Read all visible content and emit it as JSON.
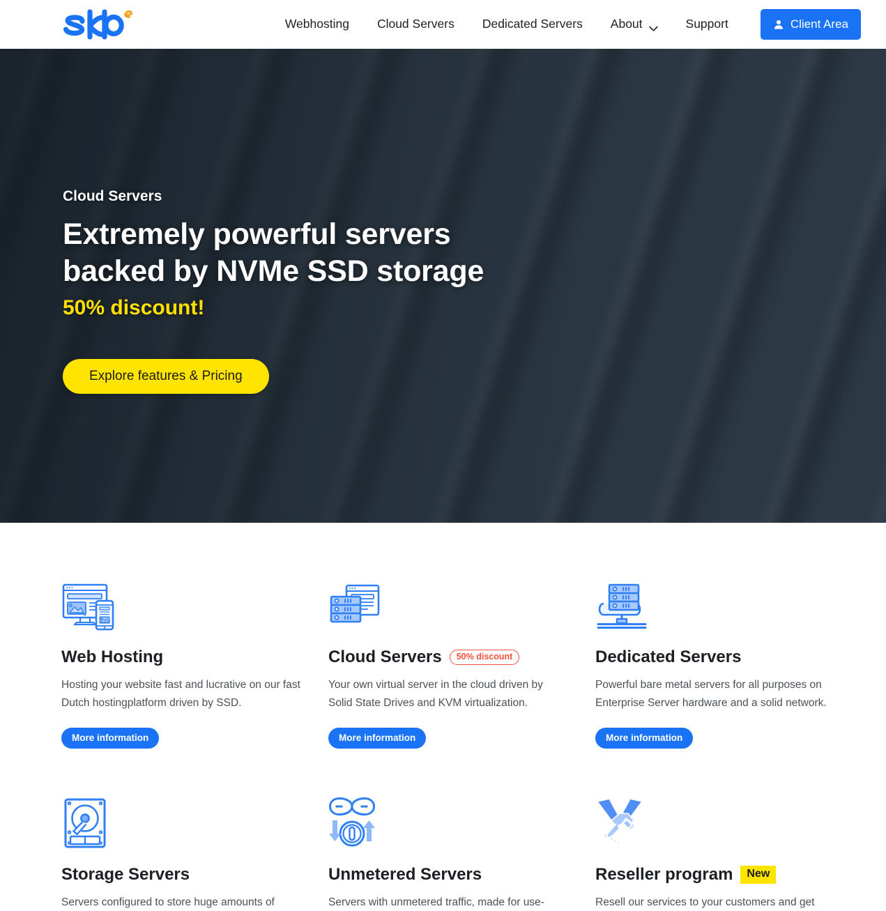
{
  "brand": {
    "logo_text": "skb",
    "logo_sup": "e",
    "logo_color": "#1a73f5",
    "logo_sup_color": "#f5a623"
  },
  "header": {
    "nav": [
      {
        "label": "Webhosting",
        "icon": ""
      },
      {
        "label": "Cloud Servers",
        "icon": ""
      },
      {
        "label": "Dedicated Servers",
        "icon": ""
      },
      {
        "label": "About",
        "icon": "chevron-down-icon"
      },
      {
        "label": "Support",
        "icon": ""
      }
    ],
    "client_area": {
      "label": "Client Area",
      "icon": "user-icon",
      "color": "#1a73f5"
    }
  },
  "hero": {
    "eyebrow": "Cloud Servers",
    "title_line1": "Extremely powerful servers",
    "title_line2": "backed by NVMe SSD storage",
    "discount": "50% discount!",
    "discount_color": "#ffe000",
    "cta_label": "Explore features & Pricing",
    "cta_color": "#ffe400",
    "background": "blurred-server-rack-photo"
  },
  "services": {
    "cards": [
      {
        "icon": "web-hosting-icon",
        "title": "Web Hosting",
        "badge": null,
        "badge_type": null,
        "desc": "Hosting your website fast and lucrative on our fast Dutch hostingplatform driven by SSD.",
        "button": "More information"
      },
      {
        "icon": "cloud-servers-icon",
        "title": "Cloud Servers",
        "badge": "50% discount",
        "badge_type": "discount",
        "badge_color": "#f4523b",
        "desc": "Your own virtual server in the cloud driven by Solid State Drives and KVM virtualization.",
        "button": "More information"
      },
      {
        "icon": "dedicated-servers-icon",
        "title": "Dedicated Servers",
        "badge": null,
        "badge_type": null,
        "desc": "Powerful bare metal servers for all purposes on Enterprise Server hardware and a solid network.",
        "button": "More information"
      },
      {
        "icon": "storage-servers-icon",
        "title": "Storage Servers",
        "badge": null,
        "badge_type": null,
        "desc": "Servers configured to store huge amounts of",
        "button": null
      },
      {
        "icon": "unmetered-servers-icon",
        "title": "Unmetered Servers",
        "badge": null,
        "badge_type": null,
        "desc": "Servers with unmetered traffic, made for use-",
        "button": null
      },
      {
        "icon": "reseller-program-icon",
        "title": "Reseller program",
        "badge": "New",
        "badge_type": "new",
        "badge_color": "#ffe400",
        "desc": "Resell our services to your customers and get",
        "button": null
      }
    ]
  }
}
